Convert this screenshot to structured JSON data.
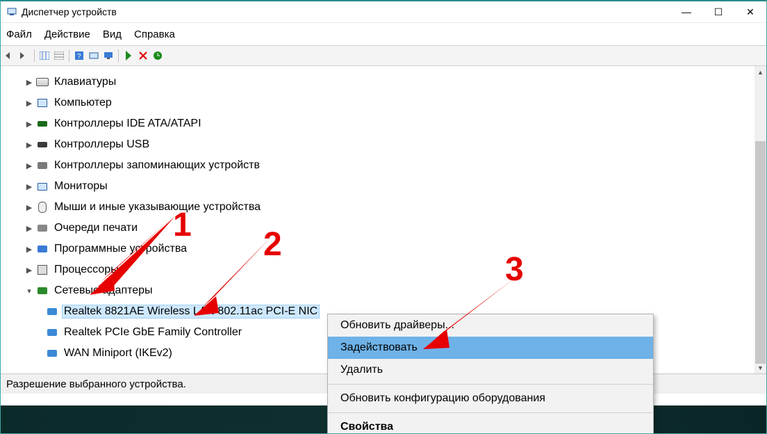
{
  "window": {
    "title": "Диспетчер устройств"
  },
  "win_controls": {
    "min": "—",
    "max": "☐",
    "close": "✕"
  },
  "menu": {
    "file": "Файл",
    "action": "Действие",
    "view": "Вид",
    "help": "Справка"
  },
  "tree": {
    "keyboards": "Клавиатуры",
    "computer": "Компьютер",
    "ide": "Контроллеры IDE ATA/ATAPI",
    "usb": "Контроллеры USB",
    "storage": "Контроллеры запоминающих устройств",
    "monitors": "Мониторы",
    "mice": "Мыши и иные указывающие устройства",
    "printq": "Очереди печати",
    "software": "Программные устройства",
    "cpu": "Процессоры",
    "netadapters": "Сетевые адаптеры",
    "nic1": "Realtek 8821AE Wireless LAN 802.11ac PCI-E NIC",
    "nic2": "Realtek PCIe GbE Family Controller",
    "nic3": "WAN Miniport (IKEv2)"
  },
  "context_menu": {
    "update": "Обновить драйверы...",
    "enable": "Задействовать",
    "delete": "Удалить",
    "scan": "Обновить конфигурацию оборудования",
    "props": "Свойства"
  },
  "status": "Разрешение выбранного устройства.",
  "annotations": {
    "n1": "1",
    "n2": "2",
    "n3": "3"
  }
}
